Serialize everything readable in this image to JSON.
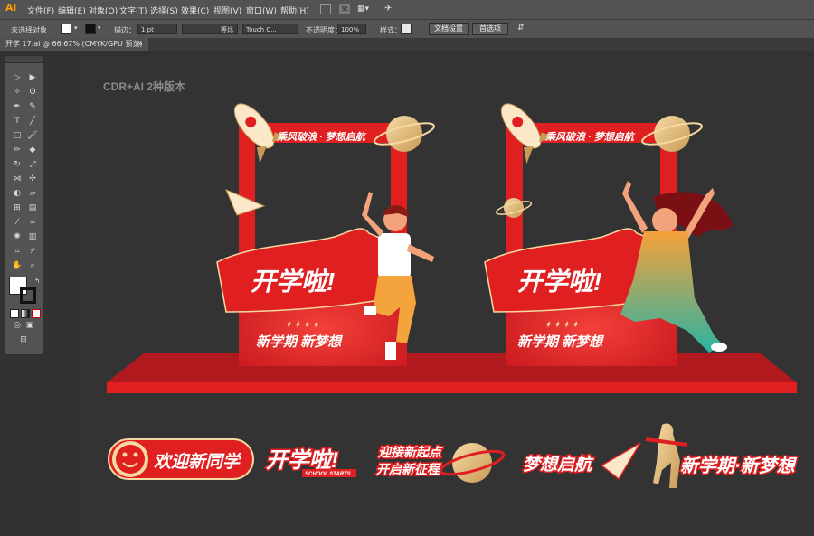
{
  "app": {
    "logo": "Ai"
  },
  "menu": {
    "items": [
      "文件(F)",
      "编辑(E)",
      "对象(O)",
      "文字(T)",
      "选择(S)",
      "效果(C)",
      "视图(V)",
      "窗口(W)",
      "帮助(H)"
    ],
    "icons": [
      "bridge-icon",
      "stock-icon",
      "workspace-icon",
      "brush-icon"
    ]
  },
  "control": {
    "selection": "未选择对象",
    "stroke_label": "描边：",
    "stroke_value": "1 pt",
    "profile_value": "等比",
    "brush_value": "Touch C...",
    "opacity_label": "不透明度：",
    "opacity_value": "100%",
    "style_label": "样式：",
    "doc_setup": "文档设置",
    "preferences": "首选项"
  },
  "tab": {
    "title": "开学 17.ai @ 66.67% (CMYK/GPU 预览)",
    "close": "×"
  },
  "artboard": {
    "label": "CDR+AI 2种版本"
  },
  "design": {
    "slogan_top": "乘风破浪 · 梦想启航",
    "headline": "开学啦!",
    "stars": "✦ ✦ ✦ ✦",
    "subline": "新学期 新梦想",
    "elements": [
      {
        "text": "欢迎新同学"
      },
      {
        "text": "开学啦!",
        "sub": "SCHOOL STARTS"
      },
      {
        "text": "迎接新起点",
        "line2": "开启新征程"
      },
      {
        "text": "梦想启航"
      },
      {
        "text": "新学期·新梦想"
      }
    ]
  },
  "colors": {
    "red": "#e01f21",
    "dark_red": "#a8141a",
    "gold": "#e8c58a",
    "canvas": "#333333"
  }
}
